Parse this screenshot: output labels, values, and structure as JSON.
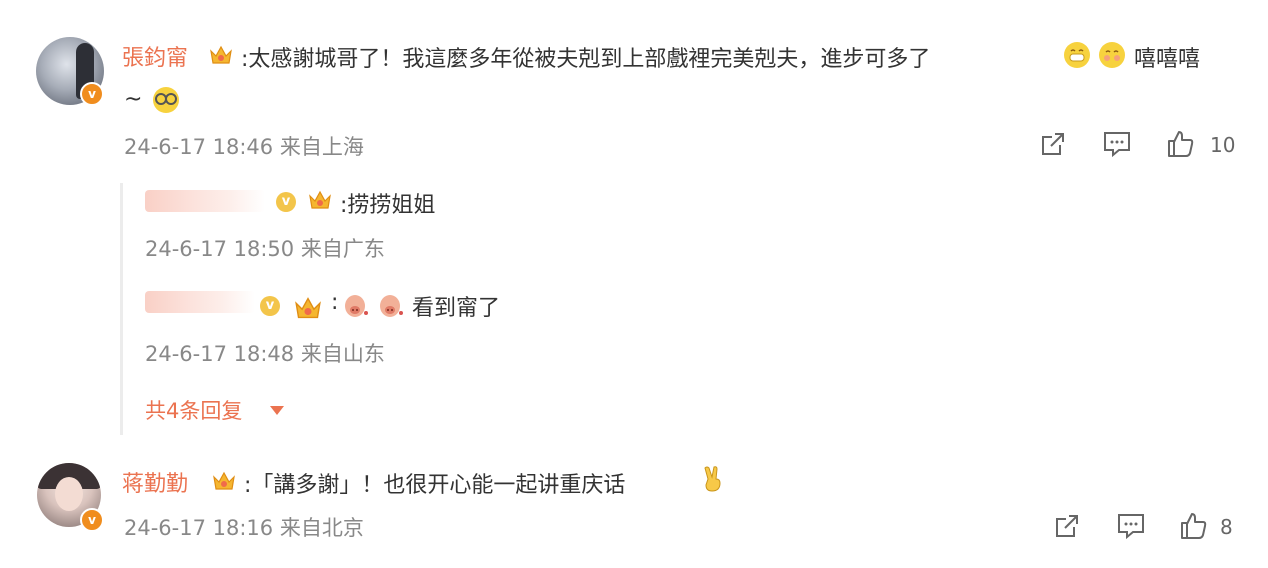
{
  "comments": [
    {
      "author": "張鈞甯",
      "text_line1": ":太感謝城哥了！我這麼多年從被夫剋到上部戲裡完美剋夫，進步可多了",
      "text_after_emoji": "嘻嘻嘻",
      "text_line2": "~",
      "meta": "24-6-17 18:46 来自上海",
      "likes": "10",
      "replies": [
        {
          "text": ":捞捞姐姐",
          "meta": "24-6-17 18:50 来自广东"
        },
        {
          "text_prefix": ":",
          "text": "看到甯了",
          "meta": "24-6-17 18:48 来自山东"
        }
      ],
      "more_replies": "共4条回复"
    },
    {
      "author": "蒋勤勤",
      "text": ":「講多謝」！也很开心能一起讲重庆话",
      "meta": "24-6-17 18:16 来自北京",
      "likes": "8"
    }
  ],
  "icons": {
    "share": "share-icon",
    "comment": "comment-icon",
    "like": "thumbs-up-icon",
    "verified": "verified-badge-icon",
    "crown": "crown-icon"
  },
  "colors": {
    "name": "#eb7350",
    "meta": "#888888",
    "verified_orange": "#f08d1e",
    "verified_gold": "#f3c54a"
  }
}
